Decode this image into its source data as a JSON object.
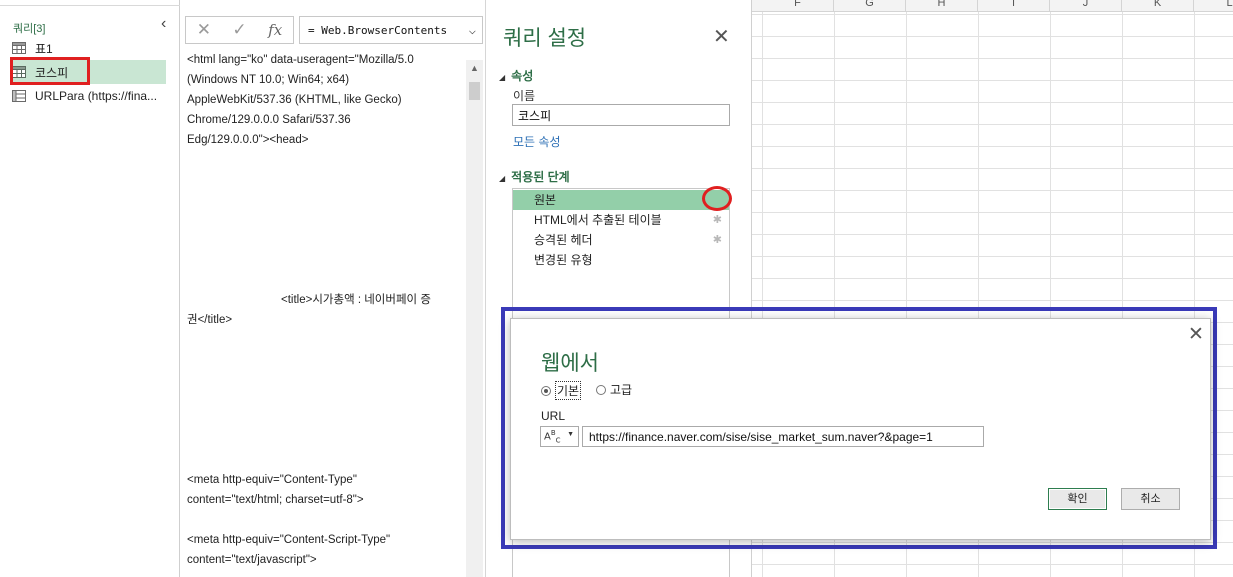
{
  "excel": {
    "columns": [
      "F",
      "G",
      "H",
      "I",
      "J",
      "K",
      "L"
    ]
  },
  "queries_panel": {
    "header": "쿼리[3]",
    "collapse_icon": "chevron-left-icon",
    "items": [
      {
        "label": "표1",
        "icon": "table-icon",
        "selected": false
      },
      {
        "label": "코스피",
        "icon": "table-icon",
        "selected": true
      },
      {
        "label": "URLPara (https://fina...",
        "icon": "param-table-icon",
        "selected": false
      }
    ]
  },
  "formula": {
    "cancel_icon": "✕",
    "confirm_icon": "✓",
    "fx_icon": "fx",
    "text": "= Web.BrowserContents"
  },
  "preview": {
    "lines": [
      "<html lang=\"ko\" data-useragent=\"Mozilla/5.0",
      "(Windows NT 10.0; Win64; x64)",
      "AppleWebKit/537.36 (KHTML, like Gecko)",
      "Chrome/129.0.0.0 Safari/537.36",
      "Edg/129.0.0.0\"><head>",
      "<title>시가총액 : 네이버페이 증",
      "권</title>",
      "<meta http-equiv=\"Content-Type\"",
      "content=\"text/html; charset=utf-8\">",
      "<meta http-equiv=\"Content-Script-Type\"",
      "content=\"text/javascript\">"
    ]
  },
  "settings": {
    "title": "쿼리 설정",
    "properties_header": "속성",
    "name_label": "이름",
    "name_value": "코스피",
    "all_properties_link": "모든 속성",
    "steps_header": "적용된 단계",
    "steps": [
      {
        "label": "원본",
        "active": true,
        "gear": false
      },
      {
        "label": "HTML에서 추출된 테이블",
        "active": false,
        "gear": true
      },
      {
        "label": "승격된 헤더",
        "active": false,
        "gear": true
      },
      {
        "label": "변경된 유형",
        "active": false,
        "gear": false
      }
    ]
  },
  "dialog": {
    "title": "웹에서",
    "radio_basic": "기본",
    "radio_advanced": "고급",
    "selected_mode": "basic",
    "url_label": "URL",
    "url_value": "https://finance.naver.com/sise/sise_market_sum.naver?&page=1",
    "ok_label": "확인",
    "cancel_label": "취소"
  },
  "annotations": {
    "highlight_red": "#e02020",
    "highlight_blue": "#3a3ab8"
  }
}
